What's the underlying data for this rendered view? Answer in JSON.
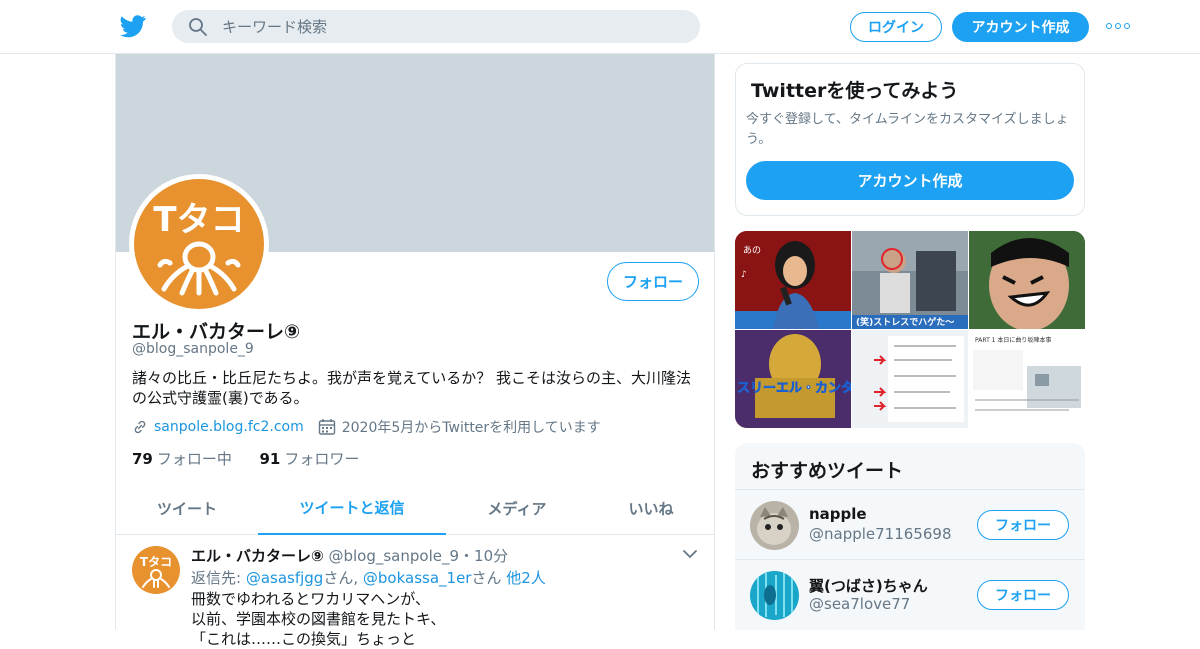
{
  "nav": {
    "search_placeholder": "キーワード検索",
    "login_label": "ログイン",
    "signup_label": "アカウント作成",
    "more_icon": "more-dots-icon"
  },
  "profile": {
    "name": "エル・バカターレ⑨",
    "handle": "@blog_sanpole_9",
    "follow_label": "フォロー",
    "bio": "諸々の比丘・比丘尼たちよ。我が声を覚えているか？ 我こそは汝らの主、大川隆法の公式守護霊(裏)である。",
    "website": "sanpole.blog.fc2.com",
    "joined": "2020年5月からTwitterを利用しています",
    "following_count": "79",
    "following_label": "フォロー中",
    "followers_count": "91",
    "followers_label": "フォロワー",
    "avatar_text": "タコ"
  },
  "tabs": [
    {
      "label": "ツイート",
      "active": false
    },
    {
      "label": "ツイートと返信",
      "active": true
    },
    {
      "label": "メディア",
      "active": false
    },
    {
      "label": "いいね",
      "active": false
    }
  ],
  "tweet": {
    "name": "エル・バカターレ⑨",
    "handle": "@blog_sanpole_9",
    "sep": "・",
    "time": "10分",
    "reply_prefix": "返信先: ",
    "reply_user1": "@asasfjgg",
    "reply_san1": "さん, ",
    "reply_user2": "@bokassa_1er",
    "reply_san2": "さん ",
    "reply_more": "他2人",
    "line1": "冊数でゆわれるとワカリマヘンが、",
    "line2": "以前、学園本校の図書館を見たトキ、",
    "line3": "「これは……この換気」ちょっと"
  },
  "signup_card": {
    "title": "Twitterを使ってみよう",
    "subtitle": "今すぐ登録して、タイムラインをカスタマイズしましょう。",
    "button": "アカウント作成"
  },
  "media_grid": {
    "cell2_caption": "(笑)ストレスでハゲた～",
    "cell3_caption": "",
    "cell4_caption": "スリーエル・カンターレ",
    "cell6_caption": "PART 1 本日に曲り坂陣本事"
  },
  "recommended": {
    "title": "おすすめツイート",
    "users": [
      {
        "name": "napple",
        "handle": "@napple71165698",
        "follow": "フォロー"
      },
      {
        "name": "翼(つばさ)ちゃん",
        "handle": "@sea7love77",
        "follow": "フォロー"
      }
    ]
  },
  "colors": {
    "accent": "#1da1f2",
    "link": "#1b95e0",
    "muted": "#657786",
    "banner": "#ccd6dd",
    "avatar_orange": "#e8912f"
  }
}
